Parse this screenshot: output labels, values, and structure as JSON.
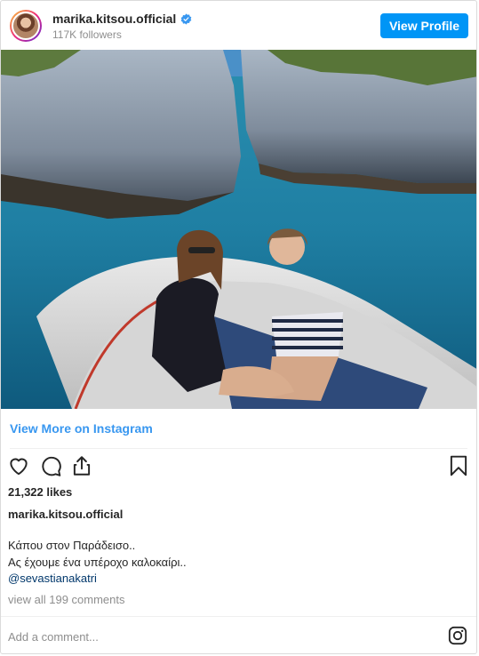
{
  "header": {
    "username": "marika.kitsou.official",
    "followers": "117K followers",
    "view_profile_label": "View Profile"
  },
  "post": {
    "view_more_label": "View More on Instagram",
    "likes": "21,322 likes",
    "caption_user": "marika.kitsou.official",
    "caption_lines": [
      "Κάπου στον Παράδεισο..",
      "Ας έχουμε ένα υπέροχο καλοκαίρι.."
    ],
    "mention": "@sevastianakatri",
    "comments_link": "view all 199 comments",
    "add_comment_placeholder": "Add a comment..."
  },
  "icons": {
    "like": "heart-icon",
    "comment": "comment-icon",
    "share": "share-icon",
    "save": "bookmark-icon",
    "verified": "verified-badge-icon",
    "instagram": "instagram-logo-icon"
  },
  "colors": {
    "accent": "#0095f6",
    "link": "#3897f0",
    "mention": "#00376b",
    "muted": "#8e8e8e"
  }
}
